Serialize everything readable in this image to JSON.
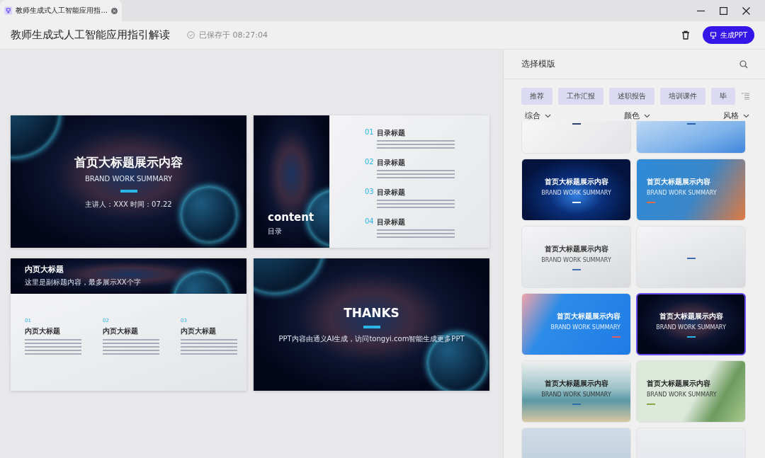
{
  "tab": {
    "title": "教师生成式人工智能应用指..."
  },
  "header": {
    "title": "教师生成式人工智能应用指引解读",
    "saved": "已保存于 08:27:04",
    "generate_button": "生成PPT"
  },
  "slides": [
    {
      "kind": "cover",
      "title": "首页大标题展示内容",
      "subtitle": "BRAND WORK SUMMARY",
      "meta": "主讲人：XXX 时间：07.22"
    },
    {
      "kind": "contents",
      "title": "content",
      "subtitle": "目录",
      "items": [
        {
          "number": "01",
          "heading": "目录标题"
        },
        {
          "number": "02",
          "heading": "目录标题"
        },
        {
          "number": "03",
          "heading": "目录标题"
        },
        {
          "number": "04",
          "heading": "目录标题"
        }
      ]
    },
    {
      "kind": "inner",
      "title": "内页大标题",
      "subtitle": "这里是副标题内容，最多展示XX个字",
      "columns": [
        {
          "number": "01",
          "heading": "内页大标题"
        },
        {
          "number": "02",
          "heading": "内页大标题"
        },
        {
          "number": "03",
          "heading": "内页大标题"
        }
      ]
    },
    {
      "kind": "thanks",
      "title": "THANKS",
      "note": "PPT内容由通义AI生成，访问tongyi.com智能生成更多PPT"
    }
  ],
  "panel": {
    "title": "选择模版",
    "categories": [
      "推荐",
      "工作汇报",
      "述职报告",
      "培训课件",
      "毕"
    ],
    "filters": [
      "综合",
      "颜色",
      "风格"
    ],
    "templates": [
      {
        "kind": "light",
        "selected": false
      },
      {
        "kind": "wave",
        "selected": false
      },
      {
        "kind": "tech",
        "title": "首页大标题展示内容",
        "subtitle": "BRAND WORK SUMMARY",
        "selected": false
      },
      {
        "kind": "flow",
        "title": "首页大标题展示内容",
        "subtitle": "BRAND WORK SUMMARY",
        "selected": false
      },
      {
        "kind": "silver",
        "title": "首页大标题展示内容",
        "subtitle": "BRAND WORK SUMMARY",
        "selected": false
      },
      {
        "kind": "silver",
        "selected": false
      },
      {
        "kind": "anime",
        "title": "首页大标题展示内容",
        "subtitle": "BRAND WORK SUMMARY",
        "selected": false
      },
      {
        "kind": "space",
        "title": "首页大标题展示内容",
        "subtitle": "BRAND WORK SUMMARY",
        "selected": true
      },
      {
        "kind": "landscape",
        "title": "首页大标题展示内容",
        "subtitle": "BRAND WORK SUMMARY",
        "selected": false
      },
      {
        "kind": "green",
        "title": "首页大标题展示内容",
        "subtitle": "BRAND WORK SUMMARY",
        "selected": false
      },
      {
        "kind": "city",
        "selected": false
      },
      {
        "kind": "pale",
        "selected": false
      }
    ]
  }
}
